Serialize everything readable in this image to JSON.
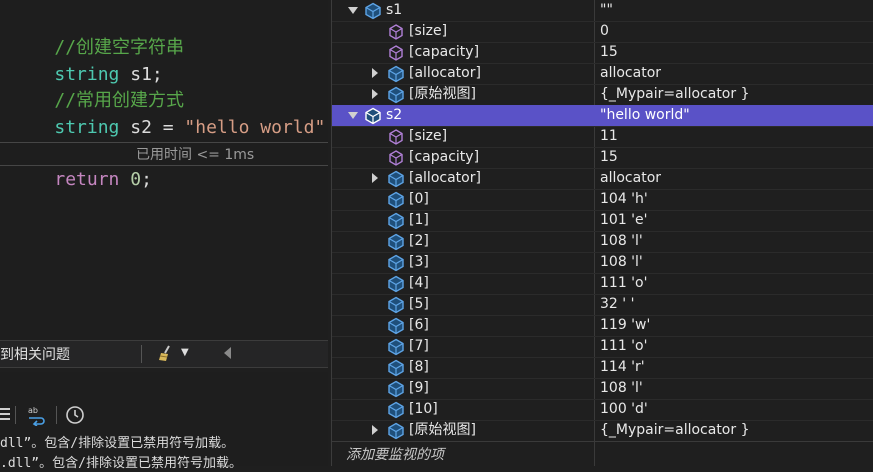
{
  "editor": {
    "lines": [
      {
        "comment": "//创建空字符串"
      },
      {
        "type": "string",
        "rest": " s1;"
      },
      {
        "comment": "//常用创建方式"
      },
      {
        "type": "string",
        "rest": " s2 = ",
        "string": "\"hello world\"",
        "end": ";"
      },
      {
        "keyword": "return",
        "number": " 0",
        "end": ";"
      }
    ],
    "elapsed_hint": "已用时间 <= 1ms"
  },
  "error_list": {
    "label": "到相关问题"
  },
  "output": {
    "lines": [
      "dll”。包含/排除设置已禁用符号加载。",
      ".dll”。包含/排除设置已禁用符号加载。"
    ]
  },
  "watch": {
    "rows": [
      {
        "name": "s1",
        "value": "\"\"",
        "indent": 0,
        "expander": "down",
        "icon": "object-icon",
        "selected": false
      },
      {
        "name": "[size]",
        "value": "0",
        "indent": 1,
        "expander": "",
        "icon": "field-icon",
        "selected": false
      },
      {
        "name": "[capacity]",
        "value": "15",
        "indent": 1,
        "expander": "",
        "icon": "field-icon",
        "selected": false
      },
      {
        "name": "[allocator]",
        "value": "allocator",
        "indent": 1,
        "expander": "right",
        "icon": "object-icon",
        "selected": false
      },
      {
        "name": "[原始视图]",
        "value": "{_Mypair=allocator }",
        "indent": 1,
        "expander": "right",
        "icon": "object-icon",
        "selected": false
      },
      {
        "name": "s2",
        "value": "\"hello world\"",
        "indent": 0,
        "expander": "down",
        "icon": "object-icon",
        "selected": true
      },
      {
        "name": "[size]",
        "value": "11",
        "indent": 1,
        "expander": "",
        "icon": "field-icon",
        "selected": false
      },
      {
        "name": "[capacity]",
        "value": "15",
        "indent": 1,
        "expander": "",
        "icon": "field-icon",
        "selected": false
      },
      {
        "name": "[allocator]",
        "value": "allocator",
        "indent": 1,
        "expander": "right",
        "icon": "object-icon",
        "selected": false
      },
      {
        "name": "[0]",
        "value": "104 'h'",
        "indent": 1,
        "expander": "",
        "icon": "object-icon",
        "selected": false
      },
      {
        "name": "[1]",
        "value": "101 'e'",
        "indent": 1,
        "expander": "",
        "icon": "object-icon",
        "selected": false
      },
      {
        "name": "[2]",
        "value": "108 'l'",
        "indent": 1,
        "expander": "",
        "icon": "object-icon",
        "selected": false
      },
      {
        "name": "[3]",
        "value": "108 'l'",
        "indent": 1,
        "expander": "",
        "icon": "object-icon",
        "selected": false
      },
      {
        "name": "[4]",
        "value": "111 'o'",
        "indent": 1,
        "expander": "",
        "icon": "object-icon",
        "selected": false
      },
      {
        "name": "[5]",
        "value": "32 ' '",
        "indent": 1,
        "expander": "",
        "icon": "object-icon",
        "selected": false
      },
      {
        "name": "[6]",
        "value": "119 'w'",
        "indent": 1,
        "expander": "",
        "icon": "object-icon",
        "selected": false
      },
      {
        "name": "[7]",
        "value": "111 'o'",
        "indent": 1,
        "expander": "",
        "icon": "object-icon",
        "selected": false
      },
      {
        "name": "[8]",
        "value": "114 'r'",
        "indent": 1,
        "expander": "",
        "icon": "object-icon",
        "selected": false
      },
      {
        "name": "[9]",
        "value": "108 'l'",
        "indent": 1,
        "expander": "",
        "icon": "object-icon",
        "selected": false
      },
      {
        "name": "[10]",
        "value": "100 'd'",
        "indent": 1,
        "expander": "",
        "icon": "object-icon",
        "selected": false
      },
      {
        "name": "[原始视图]",
        "value": "{_Mypair=allocator }",
        "indent": 1,
        "expander": "right",
        "icon": "object-icon",
        "selected": false
      }
    ],
    "add_watch_placeholder": "添加要监视的项"
  },
  "colors": {
    "selection": "#5a52c7",
    "comment": "#57a64a",
    "type": "#4ec9b0",
    "string": "#d69d85",
    "keyword": "#c586c0"
  }
}
